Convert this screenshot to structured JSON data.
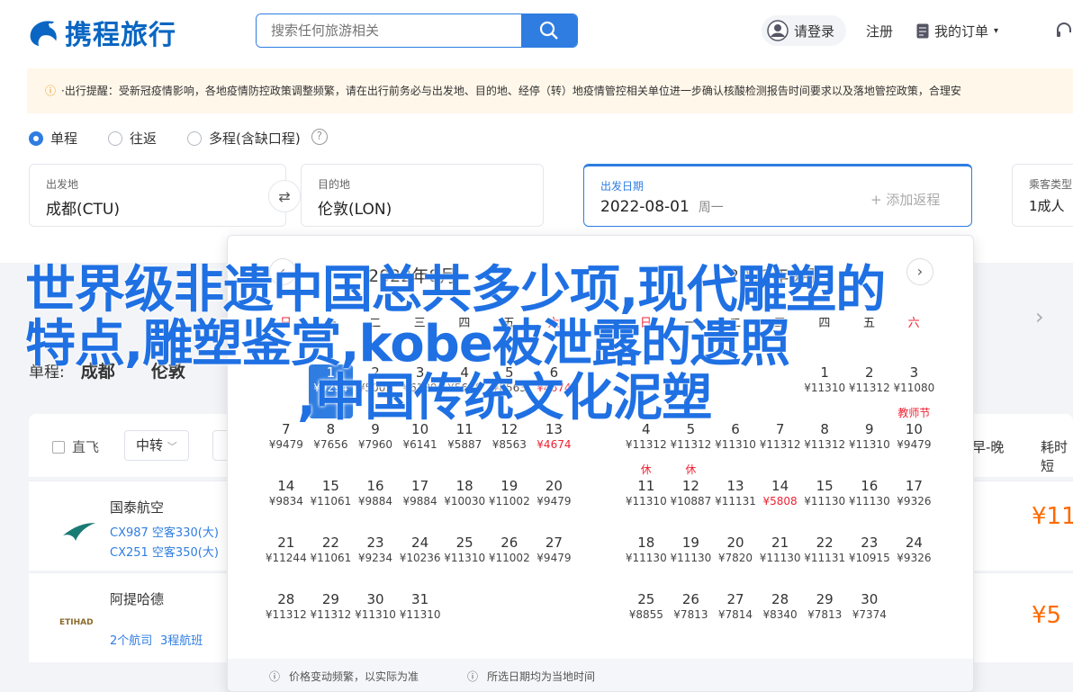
{
  "header": {
    "logo_text": "携程旅行",
    "search_placeholder": "搜索任何旅游相关",
    "login": "请登录",
    "register": "注册",
    "orders": "我的订单",
    "colors": {
      "brand": "#0a66c2",
      "accent": "#2f7de1"
    }
  },
  "notice": {
    "text": "·出行提醒：受新冠疫情影响，各地疫情防控政策调整频繁，请在出行前务必与出发地、目的地、经停（转）地疫情管控相关单位进一步确认核酸检测报告时间要求以及落地管控政策，合理安"
  },
  "trip_types": [
    "单程",
    "往返",
    "多程(含缺口程)"
  ],
  "search_form": {
    "from_label": "出发地",
    "from_value": "成都(CTU)",
    "to_label": "目的地",
    "to_value": "伦敦(LON)",
    "date_label": "出发日期",
    "date_value": "2022-08-01",
    "date_weekday": "周一",
    "add_return": "+ 添加返程",
    "pax_label": "乘客类型",
    "pax_value": "1成人"
  },
  "result_header": {
    "prefix": "单程:",
    "from": "成都",
    "to": "伦敦"
  },
  "filters": {
    "direct": "直飞",
    "transfer": "中转",
    "sort_early_late": "早-晚",
    "sort_duration": "耗时短"
  },
  "flights": [
    {
      "airline": "国泰航空",
      "line1": "CX987 空客330(大)",
      "line2": "CX251 空客350(大)",
      "price": "¥11"
    },
    {
      "airline": "阿提哈德",
      "line1": "2个航司",
      "line2": "3程航班",
      "price": "¥5"
    }
  ],
  "calendar": {
    "left_title": "2022年8月",
    "right_title": "2022年9月",
    "weekdays": [
      "日",
      "一",
      "二",
      "三",
      "四",
      "五",
      "六"
    ],
    "left_strip": [
      "",
      "¥6541"
    ],
    "left_rows": [
      [
        {
          "d": "",
          "p": ""
        },
        {
          "d": "1",
          "p": "¥9294",
          "sel": true
        },
        {
          "d": "2",
          "p": "¥5005"
        },
        {
          "d": "3",
          "p": "¥6189"
        },
        {
          "d": "4",
          "p": "¥5698"
        },
        {
          "d": "5",
          "p": "¥8563"
        },
        {
          "d": "6",
          "p": "¥4674",
          "low": true
        }
      ],
      [
        {
          "d": "7",
          "p": "¥9479"
        },
        {
          "d": "8",
          "p": "¥7656"
        },
        {
          "d": "9",
          "p": "¥7960"
        },
        {
          "d": "10",
          "p": "¥6141"
        },
        {
          "d": "11",
          "p": "¥5887"
        },
        {
          "d": "12",
          "p": "¥8563"
        },
        {
          "d": "13",
          "p": "¥4674",
          "low": true
        }
      ],
      [
        {
          "d": "14",
          "p": "¥9834"
        },
        {
          "d": "15",
          "p": "¥11061"
        },
        {
          "d": "16",
          "p": "¥9884"
        },
        {
          "d": "17",
          "p": "¥9884"
        },
        {
          "d": "18",
          "p": "¥10030"
        },
        {
          "d": "19",
          "p": "¥11002"
        },
        {
          "d": "20",
          "p": "¥9479"
        }
      ],
      [
        {
          "d": "21",
          "p": "¥11244"
        },
        {
          "d": "22",
          "p": "¥11061"
        },
        {
          "d": "23",
          "p": "¥9234"
        },
        {
          "d": "24",
          "p": "¥10236"
        },
        {
          "d": "25",
          "p": "¥11310"
        },
        {
          "d": "26",
          "p": "¥11002"
        },
        {
          "d": "27",
          "p": "¥9479"
        }
      ],
      [
        {
          "d": "28",
          "p": "¥11312"
        },
        {
          "d": "29",
          "p": "¥11312"
        },
        {
          "d": "30",
          "p": "¥11310"
        },
        {
          "d": "31",
          "p": "¥11310"
        },
        {
          "d": "",
          "p": ""
        },
        {
          "d": "",
          "p": ""
        },
        {
          "d": "",
          "p": ""
        }
      ]
    ],
    "right_rows": [
      [
        {
          "d": "",
          "p": ""
        },
        {
          "d": "",
          "p": ""
        },
        {
          "d": "",
          "p": ""
        },
        {
          "d": "",
          "p": ""
        },
        {
          "d": "1",
          "p": "¥11310"
        },
        {
          "d": "2",
          "p": "¥11312"
        },
        {
          "d": "3",
          "p": "¥11080"
        }
      ],
      [
        {
          "d": "4",
          "p": "¥11312"
        },
        {
          "d": "5",
          "p": "¥11312"
        },
        {
          "d": "6",
          "p": "¥11310"
        },
        {
          "d": "7",
          "p": "¥11312"
        },
        {
          "d": "8",
          "p": "¥11312"
        },
        {
          "d": "9",
          "p": "¥11310"
        },
        {
          "d": "10",
          "p": "¥9479",
          "tag": "教师节"
        }
      ],
      [
        {
          "d": "11",
          "p": "¥11310",
          "tag": "休"
        },
        {
          "d": "12",
          "p": "¥10887",
          "tag": "休"
        },
        {
          "d": "13",
          "p": "¥11131"
        },
        {
          "d": "14",
          "p": "¥5808",
          "low": true
        },
        {
          "d": "15",
          "p": "¥11130"
        },
        {
          "d": "16",
          "p": "¥11130"
        },
        {
          "d": "17",
          "p": "¥9326"
        }
      ],
      [
        {
          "d": "18",
          "p": "¥11130"
        },
        {
          "d": "19",
          "p": "¥11130"
        },
        {
          "d": "20",
          "p": "¥7820"
        },
        {
          "d": "21",
          "p": "¥11130"
        },
        {
          "d": "22",
          "p": "¥11131"
        },
        {
          "d": "23",
          "p": "¥10915"
        },
        {
          "d": "24",
          "p": "¥9326"
        }
      ],
      [
        {
          "d": "25",
          "p": "¥8855"
        },
        {
          "d": "26",
          "p": "¥7813"
        },
        {
          "d": "27",
          "p": "¥7814"
        },
        {
          "d": "28",
          "p": "¥8340"
        },
        {
          "d": "29",
          "p": "¥7813"
        },
        {
          "d": "30",
          "p": "¥7374"
        },
        {
          "d": "",
          "p": ""
        }
      ]
    ],
    "foot_price_note": "价格变动频繁，以实际为准",
    "foot_time_note": "所选日期均为当地时间"
  },
  "overlay": {
    "line1": "世界级非遗中国总共多少项,现代雕塑的",
    "line2": "特点,雕塑鉴赏,kobe被泄露的遗照",
    "line3": ",中国传统文化泥塑"
  }
}
